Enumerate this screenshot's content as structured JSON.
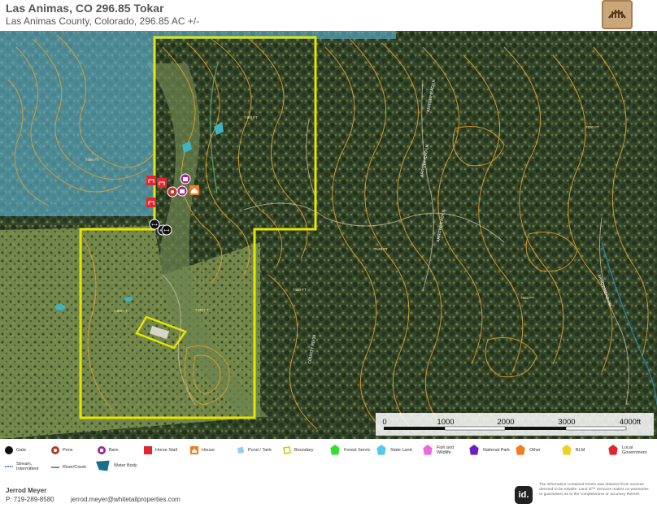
{
  "header": {
    "title": "Las Animas, CO 296.85 Tokar",
    "subtitle": "Las Animas County, Colorado, 296.85 AC +/-"
  },
  "map": {
    "colors": {
      "boundary": "#e6e600",
      "contour": "#e0a02a",
      "state_land": "#5fb4d6",
      "forest": "#2c3b1e",
      "meadow": "#8fa560"
    },
    "contour_labels": [
      "7400 FT",
      "7480 FT",
      "7520 FT",
      "7360 FT",
      "7440 FT",
      "7320 FT",
      "7560 FT",
      "7600 FT"
    ],
    "road_labels": [
      "COUNTY RD 39",
      "ARROWHEAD LN",
      "ARROWHEAD LN",
      "ARROWHEAD LN",
      "ARROWHEAD DR"
    ],
    "scale": {
      "ticks": [
        "0",
        "1000",
        "2000",
        "3000",
        "4000ft"
      ]
    }
  },
  "legend": {
    "items": [
      {
        "label": "Gate",
        "icon": "gate-icon",
        "color": "#111111"
      },
      {
        "label": "Pens",
        "icon": "pens-icon",
        "color": "#b83a2a"
      },
      {
        "label": "Barn",
        "icon": "barn-icon",
        "color": "#9b2c8f"
      },
      {
        "label": "Horse Stall",
        "icon": "horse-stall-icon",
        "color": "#e2252e"
      },
      {
        "label": "House",
        "icon": "house-icon",
        "color": "#f07d22"
      },
      {
        "label": "Pond / Tank",
        "icon": "pond-icon",
        "color": "#8fd0ee"
      },
      {
        "label": "Boundary",
        "icon": "boundary-icon",
        "color": "#e6e600"
      },
      {
        "label": "Forest Servic",
        "icon": "forest-service-icon",
        "color": "#33dd33"
      },
      {
        "label": "State Land",
        "icon": "state-land-icon",
        "color": "#55c8f0"
      },
      {
        "label": "Fish and Wildlife",
        "icon": "fish-wildlife-icon",
        "color": "#ef6ad8"
      },
      {
        "label": "National Park",
        "icon": "national-park-icon",
        "color": "#6a1fc0"
      },
      {
        "label": "Other",
        "icon": "other-icon",
        "color": "#f07d22"
      },
      {
        "label": "BLM",
        "icon": "blm-icon",
        "color": "#f0d020"
      },
      {
        "label": "Local Government",
        "icon": "local-gov-icon",
        "color": "#e2252e"
      },
      {
        "label": "Stream, Intermittent",
        "icon": "stream-intermittent-icon",
        "color": "#2a6f8f"
      },
      {
        "label": "River/Creek",
        "icon": "river-icon",
        "color": "#2a6f8f"
      },
      {
        "label": "Water Body",
        "icon": "water-body-icon",
        "color": "#1a6f8f"
      }
    ]
  },
  "footer": {
    "agent_name": "Jerrod Meyer",
    "phone": "P: 719-289-8580",
    "email": "jerrod.meyer@whitetailproperties.com",
    "disclaimer": "The information contained herein was obtained from sources deemed to be reliable. Land id™ Services makes no warranties or guarantees as to the completeness or accuracy thereof.",
    "id_logo": "id."
  }
}
